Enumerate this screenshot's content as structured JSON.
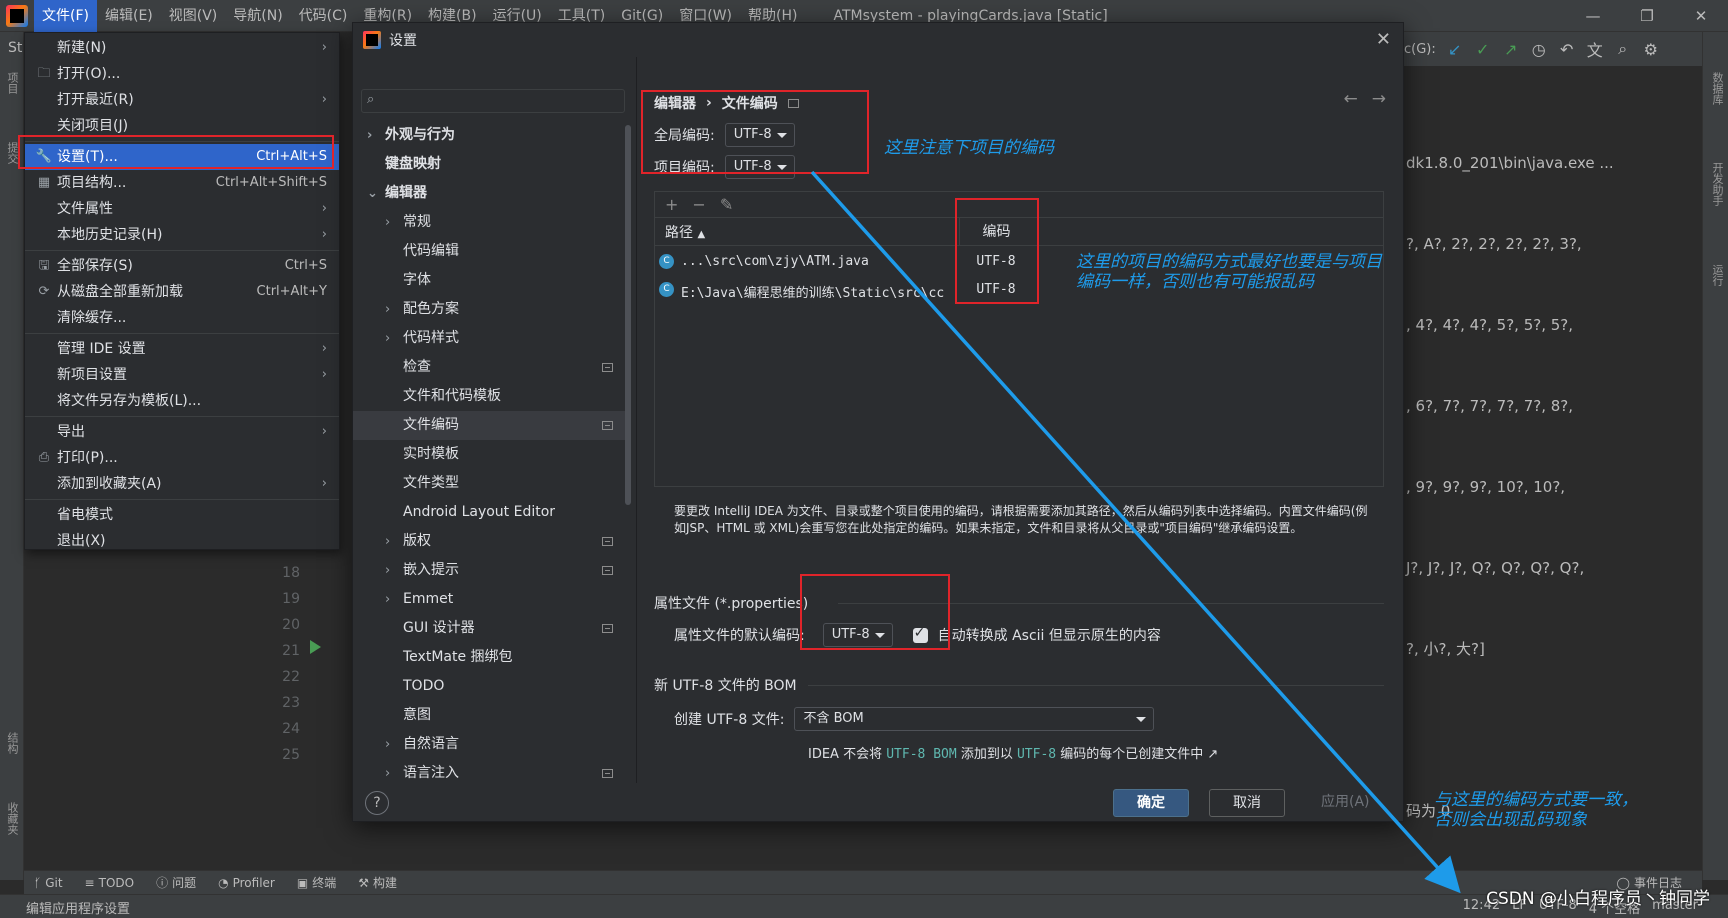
{
  "menubar": {
    "items": [
      "文件(F)",
      "编辑(E)",
      "视图(V)",
      "导航(N)",
      "代码(C)",
      "重构(R)",
      "构建(B)",
      "运行(U)",
      "工具(T)",
      "Git(G)",
      "窗口(W)",
      "帮助(H)"
    ],
    "window_title": "ATMsystem - playingCards.java [Static]"
  },
  "file_menu": {
    "items": [
      {
        "label": "新建(N)",
        "shortcut": "",
        "submenu": true,
        "icon": ""
      },
      {
        "label": "打开(O)...",
        "shortcut": "",
        "submenu": false,
        "icon": "folder-icon"
      },
      {
        "label": "打开最近(R)",
        "shortcut": "",
        "submenu": true,
        "icon": ""
      },
      {
        "label": "关闭项目(J)",
        "shortcut": "",
        "submenu": false,
        "icon": ""
      },
      {
        "label": "设置(T)...",
        "shortcut": "Ctrl+Alt+S",
        "submenu": false,
        "icon": "wrench-icon",
        "selected": true
      },
      {
        "label": "项目结构...",
        "shortcut": "Ctrl+Alt+Shift+S",
        "submenu": false,
        "icon": "project-structure-icon"
      },
      {
        "label": "文件属性",
        "shortcut": "",
        "submenu": true,
        "icon": ""
      },
      {
        "label": "本地历史记录(H)",
        "shortcut": "",
        "submenu": true,
        "icon": ""
      },
      {
        "label": "全部保存(S)",
        "shortcut": "Ctrl+S",
        "submenu": false,
        "icon": "save-icon"
      },
      {
        "label": "从磁盘全部重新加载",
        "shortcut": "Ctrl+Alt+Y",
        "submenu": false,
        "icon": "reload-icon"
      },
      {
        "label": "清除缓存...",
        "shortcut": "",
        "submenu": false,
        "icon": ""
      },
      {
        "label": "管理 IDE 设置",
        "shortcut": "",
        "submenu": true,
        "icon": ""
      },
      {
        "label": "新项目设置",
        "shortcut": "",
        "submenu": true,
        "icon": ""
      },
      {
        "label": "将文件另存为模板(L)...",
        "shortcut": "",
        "submenu": false,
        "icon": ""
      },
      {
        "label": "导出",
        "shortcut": "",
        "submenu": true,
        "icon": ""
      },
      {
        "label": "打印(P)...",
        "shortcut": "",
        "submenu": false,
        "icon": "print-icon"
      },
      {
        "label": "添加到收藏夹(A)",
        "shortcut": "",
        "submenu": true,
        "icon": ""
      },
      {
        "label": "省电模式",
        "shortcut": "",
        "submenu": false,
        "icon": ""
      },
      {
        "label": "退出(X)",
        "shortcut": "",
        "submenu": false,
        "icon": ""
      }
    ]
  },
  "dialog": {
    "title": "设置",
    "tree": [
      {
        "label": "外观与行为",
        "level": 0,
        "chevron": "›",
        "badge": false
      },
      {
        "label": "键盘映射",
        "level": 0,
        "chevron": "",
        "badge": false
      },
      {
        "label": "编辑器",
        "level": 0,
        "chevron": "⌄",
        "badge": false
      },
      {
        "label": "常规",
        "level": 1,
        "chevron": "›",
        "badge": false
      },
      {
        "label": "代码编辑",
        "level": 1,
        "chevron": "",
        "badge": false
      },
      {
        "label": "字体",
        "level": 1,
        "chevron": "",
        "badge": false
      },
      {
        "label": "配色方案",
        "level": 1,
        "chevron": "›",
        "badge": false
      },
      {
        "label": "代码样式",
        "level": 1,
        "chevron": "›",
        "badge": false
      },
      {
        "label": "检查",
        "level": 1,
        "chevron": "",
        "badge": true
      },
      {
        "label": "文件和代码模板",
        "level": 1,
        "chevron": "",
        "badge": false
      },
      {
        "label": "文件编码",
        "level": 1,
        "chevron": "",
        "badge": true,
        "selected": true
      },
      {
        "label": "实时模板",
        "level": 1,
        "chevron": "",
        "badge": false
      },
      {
        "label": "文件类型",
        "level": 1,
        "chevron": "",
        "badge": false
      },
      {
        "label": "Android Layout Editor",
        "level": 1,
        "chevron": "",
        "badge": false
      },
      {
        "label": "版权",
        "level": 1,
        "chevron": "›",
        "badge": true
      },
      {
        "label": "嵌入提示",
        "level": 1,
        "chevron": "›",
        "badge": true
      },
      {
        "label": "Emmet",
        "level": 1,
        "chevron": "›",
        "badge": false
      },
      {
        "label": "GUI 设计器",
        "level": 1,
        "chevron": "",
        "badge": true
      },
      {
        "label": "TextMate 捆绑包",
        "level": 1,
        "chevron": "",
        "badge": false
      },
      {
        "label": "TODO",
        "level": 1,
        "chevron": "",
        "badge": false
      },
      {
        "label": "意图",
        "level": 1,
        "chevron": "",
        "badge": false
      },
      {
        "label": "自然语言",
        "level": 1,
        "chevron": "›",
        "badge": false
      },
      {
        "label": "语言注入",
        "level": 1,
        "chevron": "›",
        "badge": true
      }
    ],
    "breadcrumb": {
      "parent": "编辑器",
      "sep": "›",
      "current": "文件编码"
    },
    "global_encoding": {
      "label": "全局编码:",
      "value": "UTF-8"
    },
    "project_encoding": {
      "label": "项目编码:",
      "value": "UTF-8"
    },
    "table": {
      "tools": [
        "+",
        "−",
        "✎"
      ],
      "col_path": "路径",
      "col_encoding": "编码",
      "rows": [
        {
          "path": "...\\src\\com\\zjy\\ATM.java",
          "encoding": "UTF-8"
        },
        {
          "path": "E:\\Java\\编程思维的训练\\Static\\src\\cc",
          "encoding": "UTF-8"
        }
      ]
    },
    "description": "要更改 IntelliJ IDEA 为文件、目录或整个项目使用的编码，请根据需要添加其路径，然后从编码列表中选择编码。内置文件编码(例如JSP、HTML 或 XML)会重写您在此处指定的编码。如果未指定，文件和目录将从父目录或\"项目编码\"继承编码设置。",
    "properties": {
      "section": "属性文件 (*.properties)",
      "label": "属性文件的默认编码:",
      "value": "UTF-8",
      "checkbox_label": "自动转换成 Ascii 但显示原生的内容"
    },
    "bom": {
      "section": "新 UTF-8 文件的 BOM",
      "label": "创建 UTF-8 文件:",
      "value": "不含 BOM",
      "hint_prefix": "IDEA 不会将",
      "hint_code": "UTF-8 BOM",
      "hint_mid": "添加到以",
      "hint_code2": "UTF-8",
      "hint_suffix": "编码的每个已创建文件中 ↗"
    },
    "buttons": {
      "help": "?",
      "ok": "确定",
      "cancel": "取消",
      "apply": "应用(A)"
    }
  },
  "console": {
    "lines": [
      "dk1.8.0_201\\bin\\java.exe ...",
      "?, A?, 2?, 2?, 2?, 2?, 3?,",
      ", 4?, 4?, 4?, 5?, 5?, 5?,",
      ", 6?, 7?, 7?, 7?, 7?, 8?,",
      ", 9?, 9?, 9?, 10?, 10?,",
      "J?, J?, J?, Q?, Q?, Q?, Q?,",
      "?, 小?, 大?]",
      "",
      "码为 0"
    ]
  },
  "editor": {
    "tab_fragment": "St",
    "line_numbers": [
      "18",
      "19",
      "20",
      "21",
      "22",
      "23",
      "24",
      "25"
    ],
    "toolbar_label": "c(G):"
  },
  "left_strip": [
    "项目",
    "提交",
    "结构",
    "收藏夹"
  ],
  "right_strip": [
    "数据库",
    "开发助手",
    "运行"
  ],
  "bottom_tools": [
    {
      "label": "Git",
      "icon": "git-branch-icon"
    },
    {
      "label": "TODO",
      "icon": "list-icon"
    },
    {
      "label": "问题",
      "icon": "info-icon"
    },
    {
      "label": "Profiler",
      "icon": "profiler-icon"
    },
    {
      "label": "终端",
      "icon": "terminal-icon"
    },
    {
      "label": "构建",
      "icon": "hammer-icon"
    }
  ],
  "event_log": "事件日志",
  "status": {
    "message": "编辑应用程序设置",
    "position": "12:42",
    "line_sep": "LF",
    "encoding": "UTF-8",
    "indent": "4 个空格",
    "branch": "master"
  },
  "annotations": {
    "note1": "这里注意下项目的编码",
    "note2_line1": "这里的项目的编码方式最好也要是与项目",
    "note2_line2": "编码一样，否则也有可能报乱码",
    "note3_line1": "与这里的编码方式要一致，",
    "note3_line2": "否则会出现乱码现象",
    "accent_color": "#1e9bea",
    "box_color": "#e0242a"
  },
  "watermark": "CSDN @小白程序员丶钟同学"
}
